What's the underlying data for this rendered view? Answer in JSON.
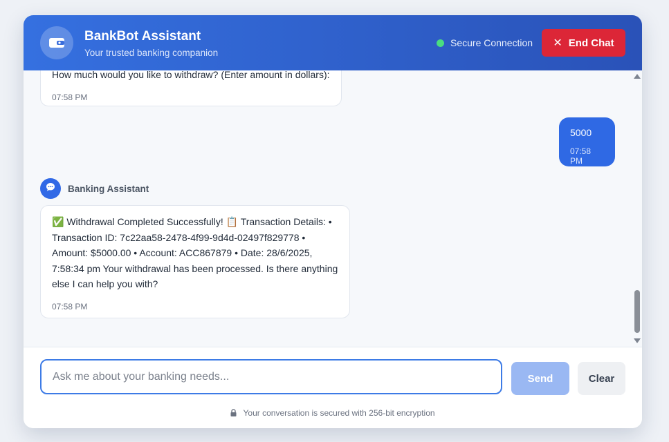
{
  "header": {
    "title": "BankBot Assistant",
    "subtitle": "Your trusted banking companion",
    "status": "Secure Connection",
    "end_chat_label": "End Chat",
    "logo_icon": "wallet-icon",
    "accent": "#2f69e4",
    "danger": "#dc2637",
    "status_color": "#4ade80"
  },
  "messages": [
    {
      "sender": "bot",
      "text": "How much would you like to withdraw? (Enter amount in dollars):",
      "time": "07:58 PM"
    },
    {
      "sender": "user",
      "text": "5000",
      "time": "07:58 PM"
    },
    {
      "sender": "bot",
      "name": "Banking Assistant",
      "avatar_icon": "chat-bubble-icon",
      "lines": [
        "✅ Withdrawal Completed Successfully! 📋 Transaction Details: •",
        "Transaction ID: 7c22aa58-2478-4f99-9d4d-02497f829778 •",
        "Amount: $5000.00 • Account: ACC867879 • Date: 28/6/2025,",
        "7:58:34 pm Your withdrawal has been processed. Is there anything",
        "else I can help you with?"
      ],
      "time": "07:58 PM"
    }
  ],
  "composer": {
    "placeholder": "Ask me about your banking needs...",
    "value": "",
    "send_label": "Send",
    "clear_label": "Clear",
    "security_note": "Your conversation is secured with 256-bit encryption"
  }
}
